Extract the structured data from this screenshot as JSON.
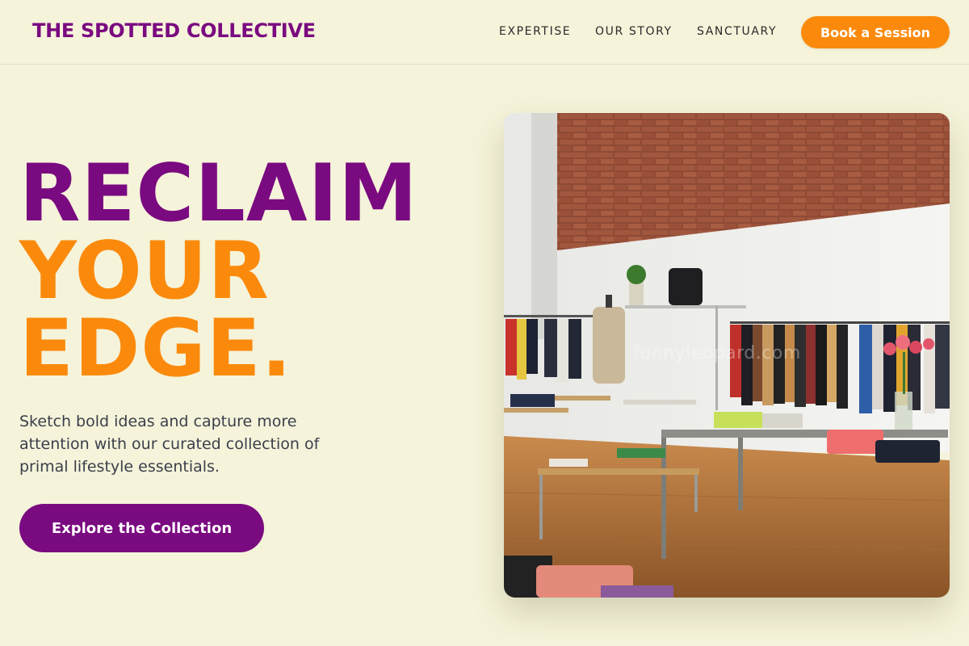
{
  "header": {
    "brand": "THE SPOTTED COLLECTIVE",
    "nav": [
      "EXPERTISE",
      "OUR STORY",
      "SANCTUARY"
    ],
    "cta": "Book a Session"
  },
  "hero": {
    "headline": [
      "RECLAIM",
      "YOUR",
      "EDGE."
    ],
    "subtitle": "Sketch bold ideas and capture more attention with our curated collection of primal lifestyle essentials.",
    "cta": "Explore the Collection",
    "image": {
      "subject": "retail-store-interior-photo",
      "watermark": "funnyleopard.com"
    }
  },
  "colors": {
    "background": "#f5f3da",
    "purple": "#7a0a80",
    "orange": "#fb8a0c",
    "text": "#3a3f4a"
  }
}
